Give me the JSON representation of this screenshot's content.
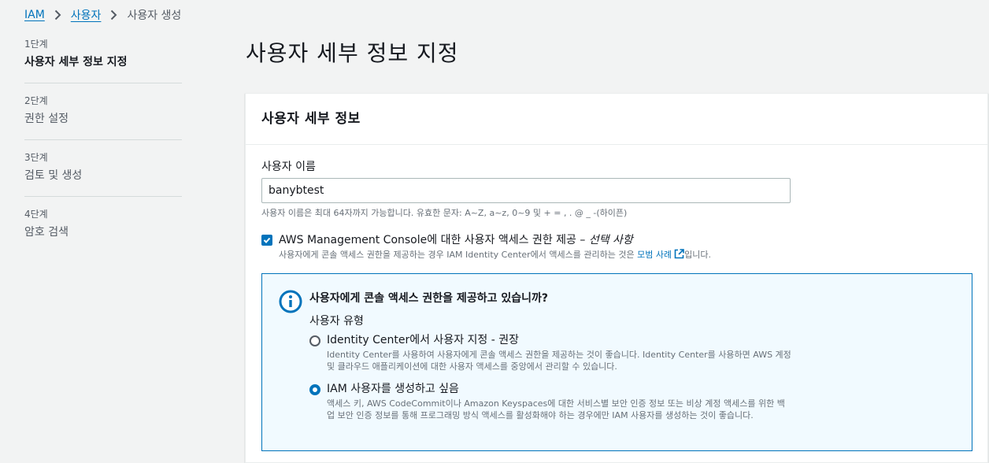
{
  "breadcrumb": {
    "root": "IAM",
    "users": "사용자",
    "current": "사용자 생성"
  },
  "steps": [
    {
      "num": "1단계",
      "title": "사용자 세부 정보 지정"
    },
    {
      "num": "2단계",
      "title": "권한 설정"
    },
    {
      "num": "3단계",
      "title": "검토 및 생성"
    },
    {
      "num": "4단계",
      "title": "암호 검색"
    }
  ],
  "page_title": "사용자 세부 정보 지정",
  "panel": {
    "title": "사용자 세부 정보",
    "username_label": "사용자 이름",
    "username_value": "banybtest",
    "username_constraint": "사용자 이름은 최대 64자까지 가능합니다. 유효한 문자: A~Z, a~z, 0~9 및 + = , . @ _ -(하이픈)",
    "console_access": {
      "checked": true,
      "label": "AWS Management Console에 대한 사용자 액세스 권한 제공 –",
      "optional": "선택 사항",
      "desc_before": "사용자에게 콘솔 액세스 권한을 제공하는 경우 IAM Identity Center에서 액세스를 관리하는 것은",
      "desc_link": "모범 사례",
      "desc_after": "입니다."
    },
    "info": {
      "title": "사용자에게 콘솔 액세스 권한을 제공하고 있습니까?",
      "user_type_label": "사용자 유형",
      "options": [
        {
          "label": "Identity Center에서 사용자 지정 - 권장",
          "desc": "Identity Center를 사용하여 사용자에게 콘솔 액세스 권한을 제공하는 것이 좋습니다. Identity Center를 사용하면 AWS 계정 및 클라우드 애플리케이션에 대한 사용자 액세스를 중앙에서 관리할 수 있습니다.",
          "selected": false
        },
        {
          "label": "IAM 사용자를 생성하고 싶음",
          "desc": "액세스 키, AWS CodeCommit이나 Amazon Keyspaces에 대한 서비스별 보안 인증 정보 또는 비상 계정 액세스를 위한 백업 보안 인증 정보를 통해 프로그래밍 방식 액세스를 활성화해야 하는 경우에만 IAM 사용자를 생성하는 것이 좋습니다.",
          "selected": true
        }
      ]
    }
  },
  "colors": {
    "accent": "#0073bb",
    "info_bg": "#f1faff",
    "page_bg": "#f2f3f3"
  }
}
